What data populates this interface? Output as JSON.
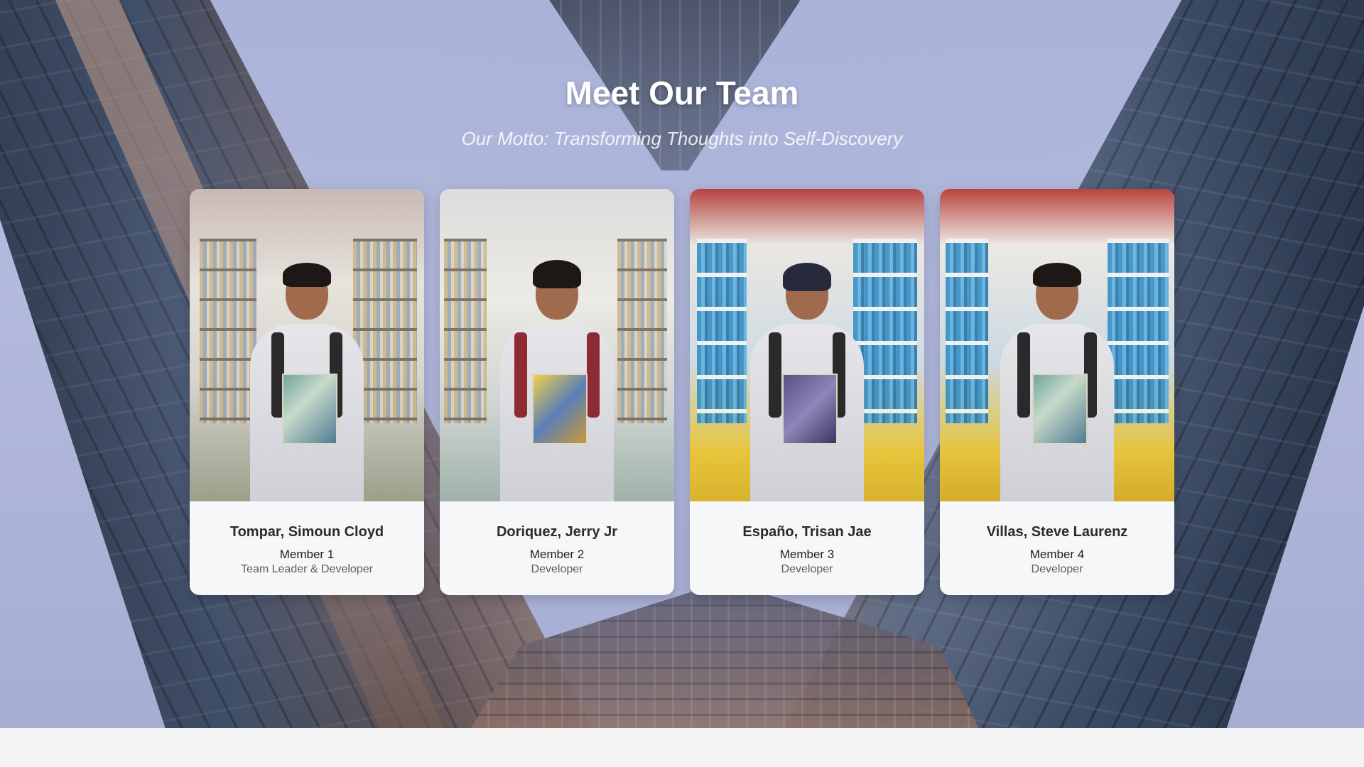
{
  "header": {
    "title": "Meet Our Team",
    "motto": "Our Motto: Transforming Thoughts into Self-Discovery"
  },
  "team": [
    {
      "name": "Tompar, Simoun Cloyd",
      "member": "Member 1",
      "role": "Team Leader & Developer"
    },
    {
      "name": "Doriquez, Jerry Jr",
      "member": "Member 2",
      "role": "Developer"
    },
    {
      "name": "Españo, Trisan Jae",
      "member": "Member 3",
      "role": "Developer"
    },
    {
      "name": "Villas, Steve Laurenz",
      "member": "Member 4",
      "role": "Developer"
    }
  ],
  "colors": {
    "background": "#aab2d8",
    "card": "#f6f7f9",
    "title_text": "#ffffff",
    "name_text": "#2b2b2b",
    "role_text": "#5c5c5c"
  },
  "icons": {
    "photo_1": "team-photo",
    "photo_2": "team-photo",
    "photo_3": "team-photo",
    "photo_4": "team-photo"
  }
}
